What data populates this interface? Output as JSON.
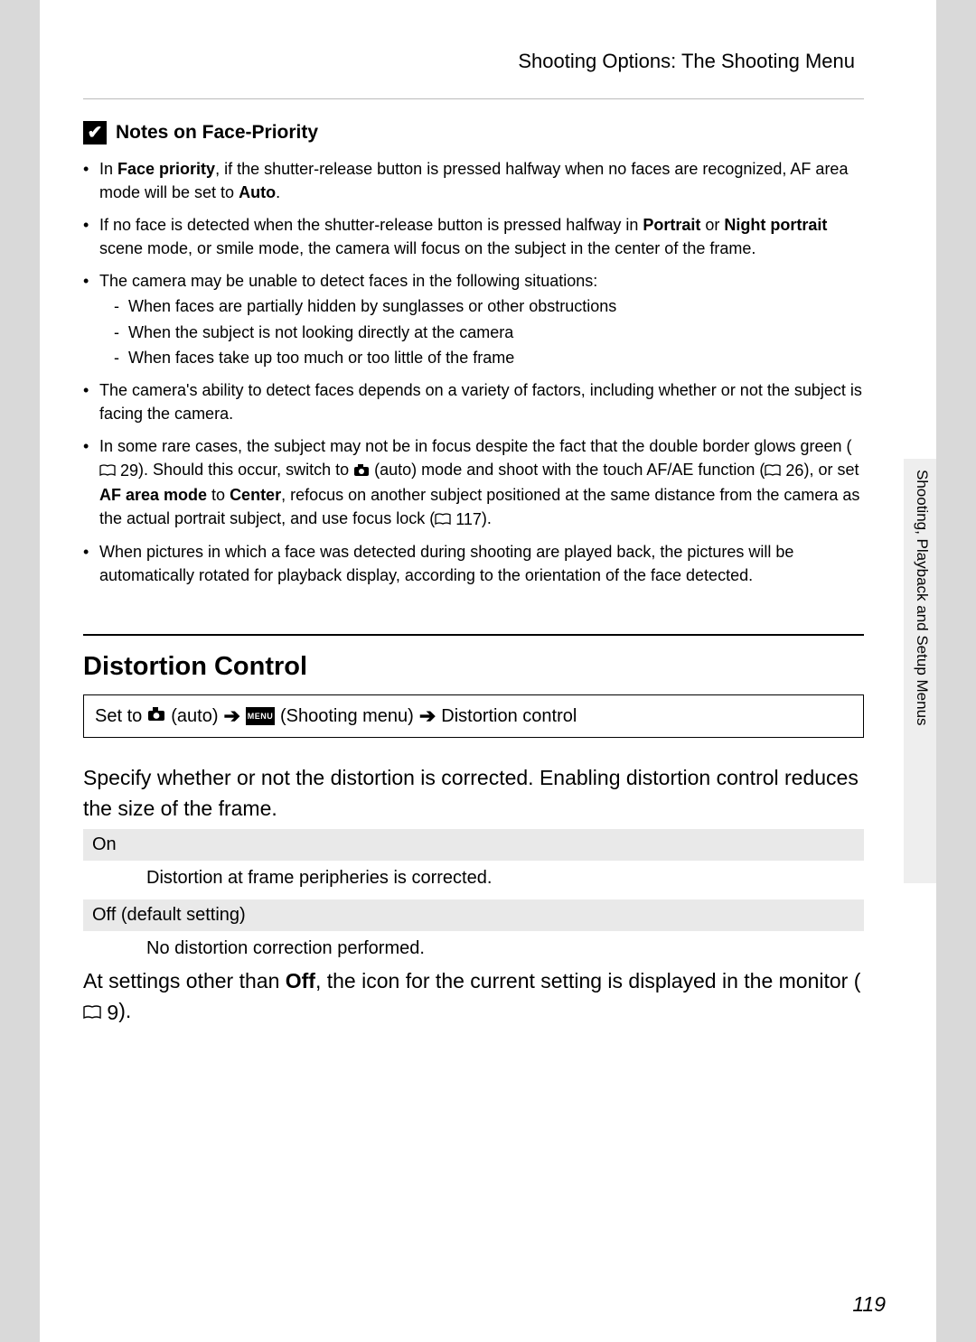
{
  "header": {
    "breadcrumb": "Shooting Options: The Shooting Menu"
  },
  "notes": {
    "heading": "Notes on Face-Priority",
    "items": {
      "b1": {
        "pre": "In ",
        "bold1": "Face priority",
        "post": ", if the shutter-release button is pressed halfway when no faces are recognized, AF area mode will be set to ",
        "bold2": "Auto",
        "end": "."
      },
      "b2": {
        "pre": "If no face is detected when the shutter-release button is pressed halfway in ",
        "bold1": "Portrait",
        "mid": " or ",
        "bold2": "Night portrait",
        "post": " scene mode, or smile mode, the camera will focus on the subject in the center of the frame."
      },
      "b3": {
        "text": "The camera may be unable to detect faces in the following situations:",
        "sub1": "When faces are partially hidden by sunglasses or other obstructions",
        "sub2": "When the subject is not looking directly at the camera",
        "sub3": "When faces take up too much or too little of the frame"
      },
      "b4": "The camera's ability to detect faces depends on a variety of factors, including whether or not the subject is facing the camera.",
      "b5": {
        "p1": "In some rare cases, the subject may not be in focus despite the fact that the double border glows green (",
        "ref1": "29",
        "p2": "). Should this occur, switch to ",
        "p3": " (auto) mode and shoot with the touch AF/AE function (",
        "ref2": "26",
        "p4": "), or set ",
        "bold1": "AF area mode",
        "p5": " to ",
        "bold2": "Center",
        "p6": ", refocus on another subject positioned at the same distance from the camera as the actual portrait subject, and use focus lock (",
        "ref3": "117",
        "p7": ")."
      },
      "b6": "When pictures in which a face was detected during shooting are played back, the pictures will be automatically rotated for playback display, according to the orientation of the face detected."
    }
  },
  "distortion": {
    "title": "Distortion Control",
    "nav": {
      "setto": "Set to ",
      "auto": " (auto) ",
      "menu": " (Shooting menu) ",
      "target": " Distortion control",
      "menuLabel": "MENU"
    },
    "intro": "Specify whether or not the distortion is corrected. Enabling distortion control reduces the size of the frame.",
    "on": {
      "label": "On",
      "desc": "Distortion at frame peripheries is corrected."
    },
    "off": {
      "label": "Off (default setting)",
      "desc": "No distortion correction performed."
    },
    "footer": {
      "p1": "At settings other than ",
      "bold": "Off",
      "p2": ", the icon for the current setting is displayed in the monitor (",
      "ref": "9",
      "p3": ")."
    }
  },
  "side": {
    "label": "Shooting, Playback and Setup Menus"
  },
  "pageNumber": "119"
}
